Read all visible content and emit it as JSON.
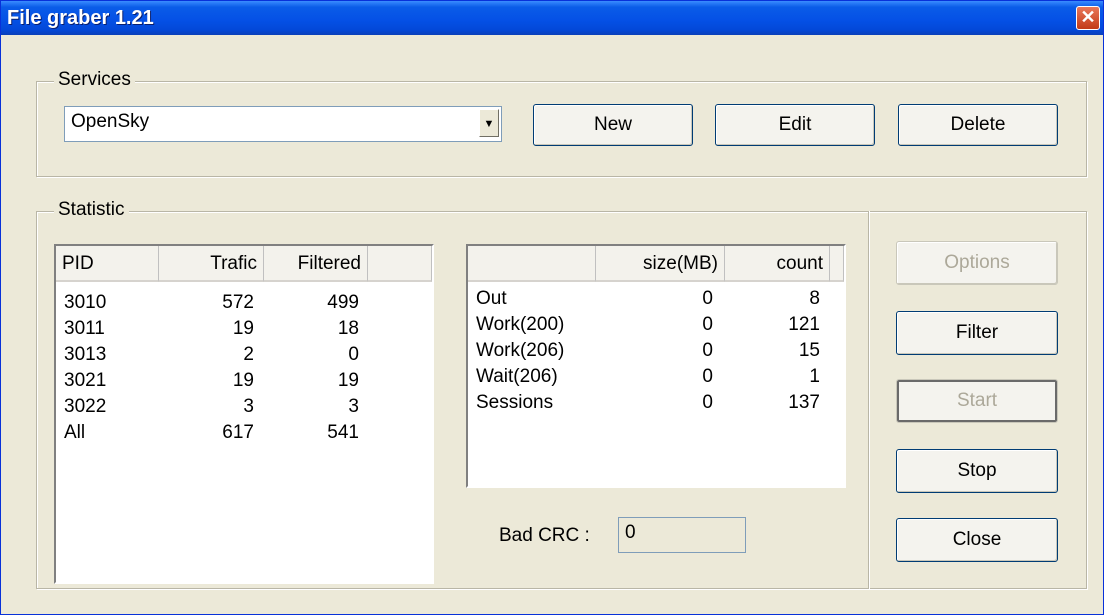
{
  "window": {
    "title": "File graber 1.21",
    "close_glyph": "✕"
  },
  "services": {
    "legend": "Services",
    "selected": "OpenSky",
    "buttons": {
      "new": "New",
      "edit": "Edit",
      "delete": "Delete"
    }
  },
  "statistic": {
    "legend": "Statistic",
    "pid_table": {
      "columns": [
        "PID",
        "Trafic",
        "Filtered"
      ],
      "rows": [
        [
          "3010",
          "572",
          "499"
        ],
        [
          "3011",
          "19",
          "18"
        ],
        [
          "3013",
          "2",
          "0"
        ],
        [
          "3021",
          "19",
          "19"
        ],
        [
          "3022",
          "3",
          "3"
        ],
        [
          "All",
          "617",
          "541"
        ]
      ]
    },
    "summary_table": {
      "columns": [
        "",
        "size(MB)",
        "count"
      ],
      "rows": [
        [
          "Out",
          "0",
          "8"
        ],
        [
          "Work(200)",
          "0",
          "121"
        ],
        [
          "Work(206)",
          "0",
          "15"
        ],
        [
          "Wait(206)",
          "0",
          "1"
        ],
        [
          "Sessions",
          "0",
          "137"
        ]
      ]
    },
    "bad_crc": {
      "label": "Bad CRC :",
      "value": "0"
    }
  },
  "side_buttons": {
    "options": "Options",
    "filter": "Filter",
    "start": "Start",
    "stop": "Stop",
    "close": "Close"
  }
}
